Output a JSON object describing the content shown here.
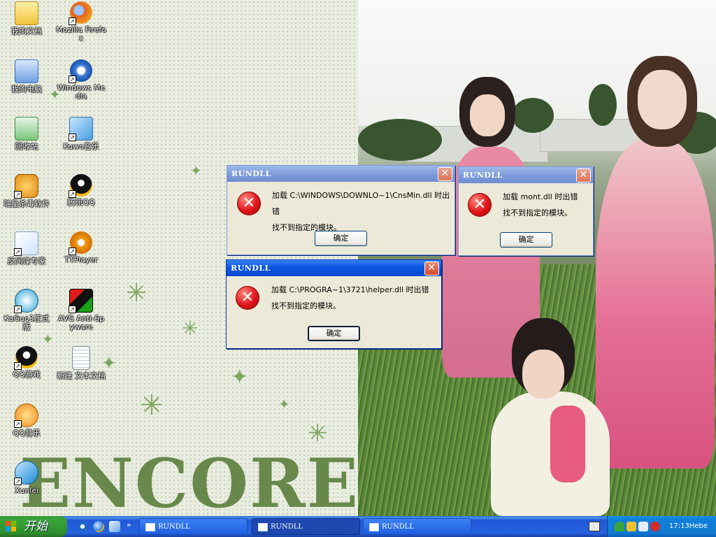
{
  "desktop": {
    "wallpaper_text": "ENCORE",
    "icons": [
      {
        "label": "我的文档",
        "icon": "my-documents-icon"
      },
      {
        "label": "Mozilla Firefox",
        "icon": "firefox-icon"
      },
      {
        "label": "我的电脑",
        "icon": "my-computer-icon"
      },
      {
        "label": "Windows Media",
        "icon": "windows-media-icon"
      },
      {
        "label": "回收站",
        "icon": "recycle-bin-icon"
      },
      {
        "label": "Kuwo音乐",
        "icon": "kuwo-music-icon"
      },
      {
        "label": "瑞星杀毒软件",
        "icon": "rising-antivirus-icon"
      },
      {
        "label": "腾讯QQ",
        "icon": "qq-icon"
      },
      {
        "label": "反间谍专家",
        "icon": "anti-spy-icon"
      },
      {
        "label": "TTPlayer",
        "icon": "ttplayer-icon"
      },
      {
        "label": "KaGuo3正式版",
        "icon": "kaguo-icon"
      },
      {
        "label": "AVG Anti-Spyware",
        "icon": "avg-antispyware-icon"
      },
      {
        "label": "QQ游戏",
        "icon": "qq-game-icon"
      },
      {
        "label": "新建 文本文档",
        "icon": "text-document-icon"
      },
      {
        "label": "QQ音乐",
        "icon": "qq-music-icon"
      },
      {
        "label": "Xunlei",
        "icon": "xunlei-icon"
      }
    ]
  },
  "dialogs": [
    {
      "title": "RUNDLL",
      "line1": "加载 C:\\WINDOWS\\DOWNLO~1\\CnsMin.dll 时出错",
      "line2": "找不到指定的模块。",
      "ok": "确定",
      "state": "inactive"
    },
    {
      "title": "RUNDLL",
      "line1": "加载 mont.dll 时出错",
      "line2": "找不到指定的模块。",
      "ok": "确定",
      "state": "inactive"
    },
    {
      "title": "RUNDLL",
      "line1": "加载 C:\\PROGRA~1\\3721\\helper.dll 时出错",
      "line2": "找不到指定的模块。",
      "ok": "确定",
      "state": "active"
    }
  ],
  "close_glyph": "✕",
  "error_glyph": "✕",
  "taskbar": {
    "start_label": "开始",
    "chevron": "»",
    "buttons": [
      {
        "label": "RUNDLL",
        "pressed": false
      },
      {
        "label": "RUNDLL",
        "pressed": true
      },
      {
        "label": "RUNDLL",
        "pressed": false
      }
    ],
    "clock": "17:13Hebe"
  },
  "colors": {
    "taskbar_blue": "#2663e0",
    "start_green": "#37a437",
    "title_active": "#0b56e0",
    "title_inactive": "#7a98d9",
    "error_red": "#e0141a"
  }
}
